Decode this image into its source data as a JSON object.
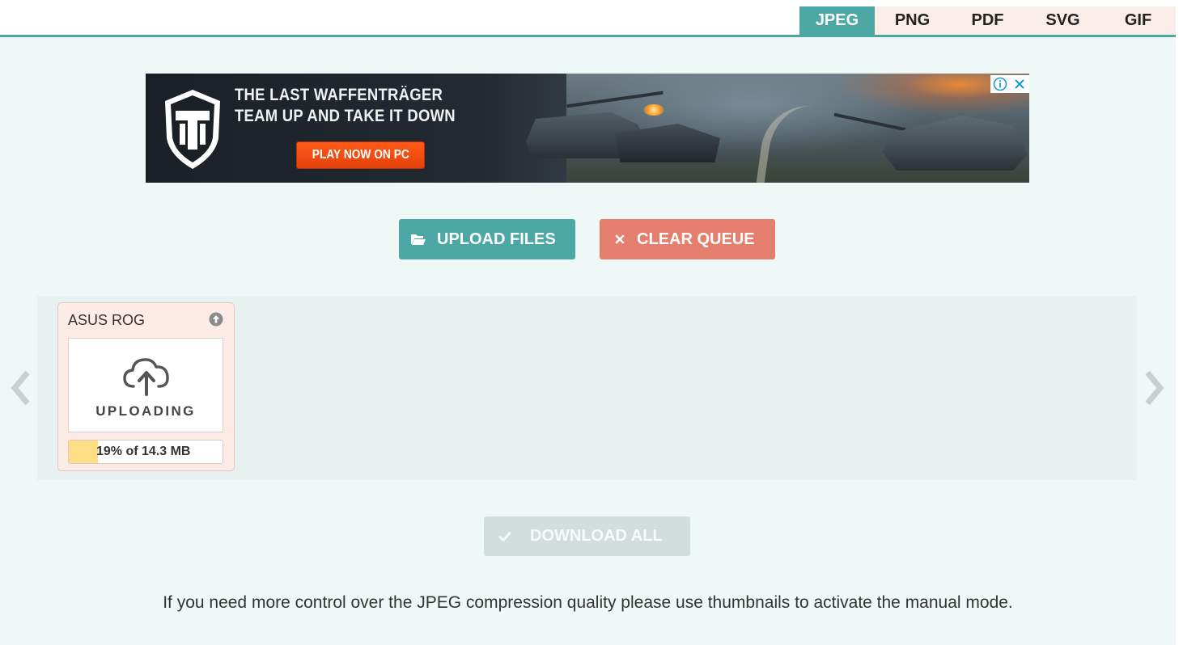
{
  "format_tabs": [
    {
      "label": "JPEG",
      "active": true
    },
    {
      "label": "PNG",
      "active": false
    },
    {
      "label": "PDF",
      "active": false
    },
    {
      "label": "SVG",
      "active": false
    },
    {
      "label": "GIF",
      "active": false
    }
  ],
  "ad": {
    "headline_line1": "THE LAST WAFFENTRÄGER",
    "headline_line2": "TEAM UP AND TAKE IT DOWN",
    "cta_label": "PLAY NOW ON PC",
    "info_icon": "info-icon",
    "close_icon": "close-icon"
  },
  "actions": {
    "upload_label": "UPLOAD FILES",
    "clear_label": "CLEAR QUEUE",
    "download_all_label": "DOWNLOAD ALL"
  },
  "queue": {
    "prev_icon": "chevron-left-icon",
    "next_icon": "chevron-right-icon",
    "items": [
      {
        "name": "ASUS ROG",
        "status": "UPLOADING",
        "progress_text": "19% of 14.3 MB",
        "progress_fraction": 0.19
      }
    ]
  },
  "footer": {
    "note": "If you need more control over the JPEG compression quality please use thumbnails to activate the manual mode."
  },
  "colors": {
    "accent": "#4ca7a5",
    "clear": "#e57f6d",
    "download_disabled": "#d2dedd",
    "progress_fill": "#fedd85",
    "background": "#eef8f7",
    "card_bg": "#fdebe6"
  }
}
